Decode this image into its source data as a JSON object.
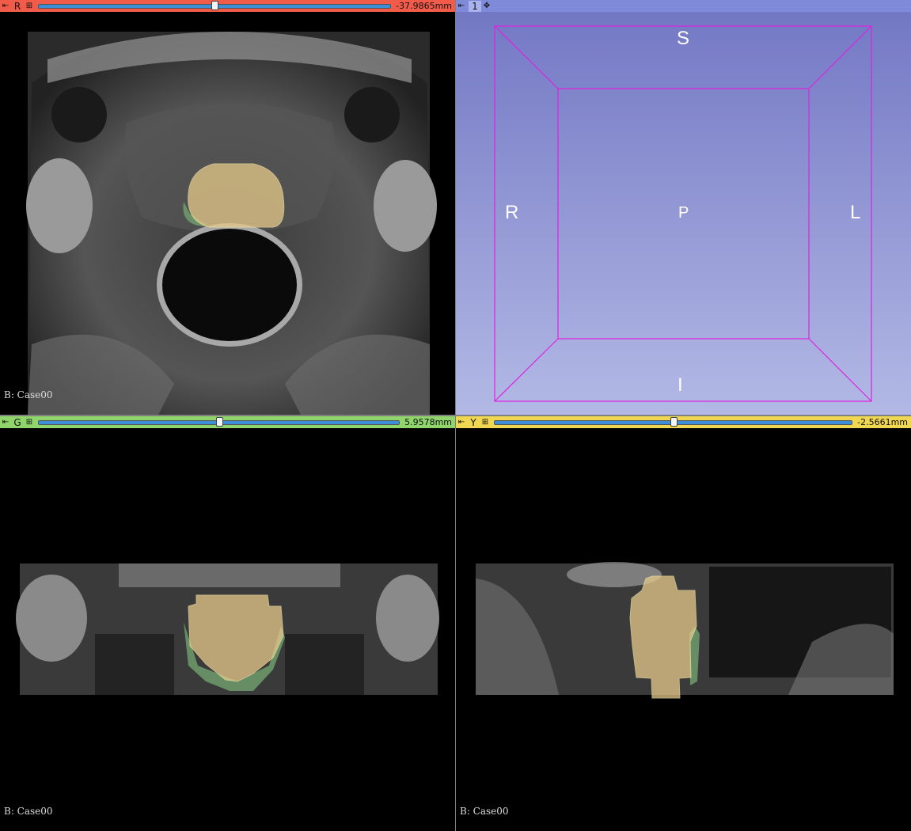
{
  "red_view": {
    "label": "R",
    "offset": "-37.9865mm",
    "slider_fraction": 0.5,
    "corner": "B: Case00"
  },
  "threeD_view": {
    "label": "1",
    "orientation": {
      "superior": "S",
      "inferior": "I",
      "right": "R",
      "left": "L",
      "posterior": "P"
    }
  },
  "green_view": {
    "label": "G",
    "offset": "5.9578mm",
    "slider_fraction": 0.5,
    "corner": "B: Case00"
  },
  "yellow_view": {
    "label": "Y",
    "offset": "-2.5661mm",
    "slider_fraction": 0.5,
    "corner": "B: Case00"
  },
  "colors": {
    "red_bar": "#f15b4a",
    "green_bar": "#8fd56b",
    "yellow_bar": "#f0d752",
    "threeD_bar": "#7f8ad8",
    "box_outline": "#e020e0",
    "segment_prostate": "#e6c98a",
    "segment_periph": "#6f9c6b"
  }
}
